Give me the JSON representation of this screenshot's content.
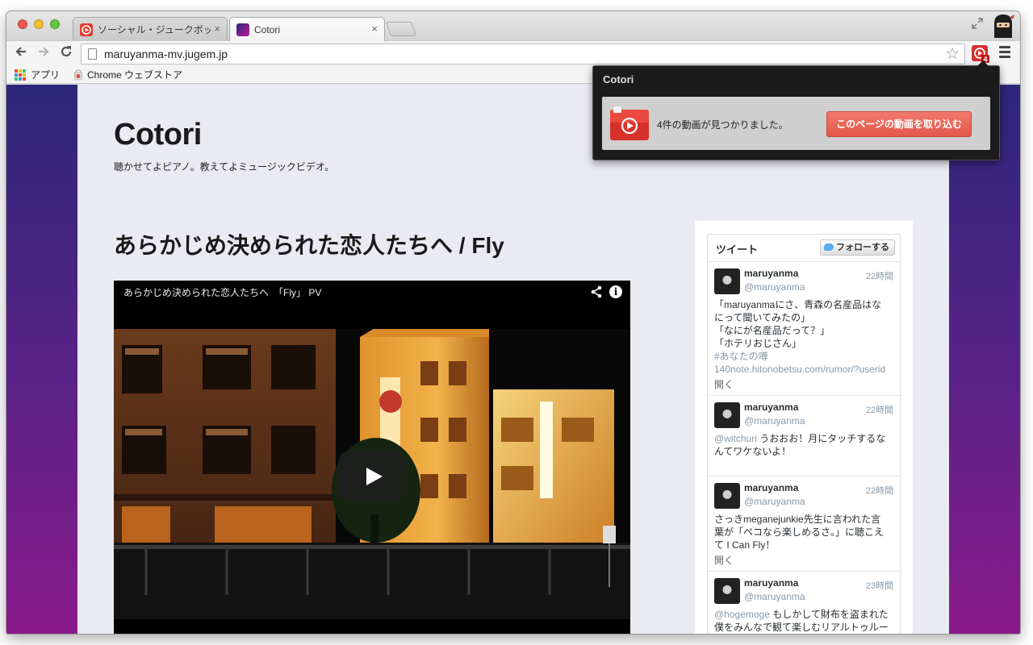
{
  "browser": {
    "tabs": [
      {
        "title": "ソーシャル・ジュークボックス",
        "active": false
      },
      {
        "title": "Cotori",
        "active": true
      }
    ],
    "tab_close": "×",
    "address": "maruyanma-mv.jugem.jp",
    "bookmarks": [
      "アプリ",
      "Chrome ウェブストア"
    ],
    "extension_badge": "4",
    "icons": {
      "back": "arrow-left-icon",
      "forward": "arrow-right-icon",
      "reload": "reload-icon",
      "star": "star-icon",
      "menu": "hamburger-icon"
    }
  },
  "site": {
    "title": "Cotori",
    "description": "聴かせてよピアノ。教えてよミュージックビデオ。",
    "post_title": "あらかじめ決められた恋人たちへ / Fly"
  },
  "video": {
    "title": "あらかじめ決められた恋人たちへ　「Fly」 PV",
    "info": "i"
  },
  "twitter": {
    "header": "ツイート",
    "follow_label": "フォローする",
    "tweets": [
      {
        "name": "maruyanma",
        "handle": "@maruyanma",
        "time": "22時間",
        "lines": [
          "「maruyanmaにさ、青森の名産品はな",
          "にって聞いてみたの」",
          "「なにが名産品だって？」",
          "「ホテリおじさん」"
        ],
        "hashtag": "#あなたの噂",
        "link": "140note.hitonobetsu.com/rumor/?userid",
        "more": "開く"
      },
      {
        "name": "maruyanma",
        "handle": "@maruyanma",
        "time": "22時間",
        "mention": "@witchuri",
        "lines": [
          " うおおお！月にタッチするな",
          "んてワケないよ！"
        ]
      },
      {
        "name": "maruyanma",
        "handle": "@maruyanma",
        "time": "22時間",
        "lines": [
          "さっきmeganejunkie先生に言われた言",
          "葉が「ペコなら楽しめるさ。」に聴こえ",
          "て I Can Fly！"
        ],
        "more": "開く"
      },
      {
        "name": "maruyanma",
        "handle": "@maruyanma",
        "time": "23時間",
        "mention": "@hogemoge",
        "lines": [
          " もしかして財布を盗まれた",
          "僕をみんなで観て楽しむリアルトゥルー"
        ]
      }
    ]
  },
  "popup": {
    "title": "Cotori",
    "message": "4件の動画が見つかりました。",
    "button": "このページの動画を取り込む"
  },
  "colors": {
    "accent_red": "#e3584b",
    "page_bg": "#eaeaf2",
    "gradient_top": "#2c267a",
    "gradient_bottom": "#8a1a8a"
  }
}
